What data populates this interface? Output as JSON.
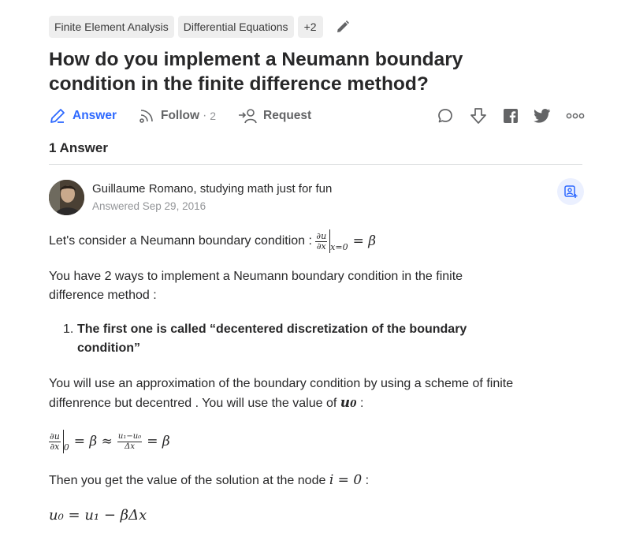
{
  "topics": [
    "Finite Element Analysis",
    "Differential Equations"
  ],
  "topics_more": "+2",
  "question": {
    "title_line1": "How do you implement a Neumann boundary",
    "title_line2": "condition in the finite difference method?"
  },
  "actions": {
    "answer_label": "Answer",
    "follow_label": "Follow",
    "follow_dot": "·",
    "follow_count": "2",
    "request_label": "Request"
  },
  "answer_count_label": "1 Answer",
  "answer": {
    "author_line": "Guillaume Romano, studying math just for fun",
    "answered_date": "Answered Sep 29, 2016",
    "p1_text": "Let's consider a Neumann boundary condition :",
    "p1_math": {
      "num": "∂u",
      "den": "∂x",
      "sub": "x=0",
      "rhs": "= β"
    },
    "p2_line1": "You have 2 ways to implement a Neumann boundary condition in the finite",
    "p2_line2": "difference method :",
    "list_number": "1.",
    "list_line1": "The first one is called “decentered discretization of the boundary",
    "list_line2": "condition”",
    "p3_line1": "You will use an approximation of the boundary condition by using a scheme of finite",
    "p3_line2": "diffenrence but decentred . You will use the value of",
    "p3_var": "u",
    "p3_var_sub": "0",
    "p3_end": ":",
    "eq1": {
      "num": "∂u",
      "den": "∂x",
      "sub": "0",
      "mid": "= β ≈",
      "num2": "u₁−u₀",
      "den2": "Δx",
      "rhs": "= β"
    },
    "p4_text": "Then you get the value of the solution at the node",
    "p4_math": "i = 0",
    "p4_end": ":",
    "eq2": "u₀ = u₁ − βΔx"
  }
}
